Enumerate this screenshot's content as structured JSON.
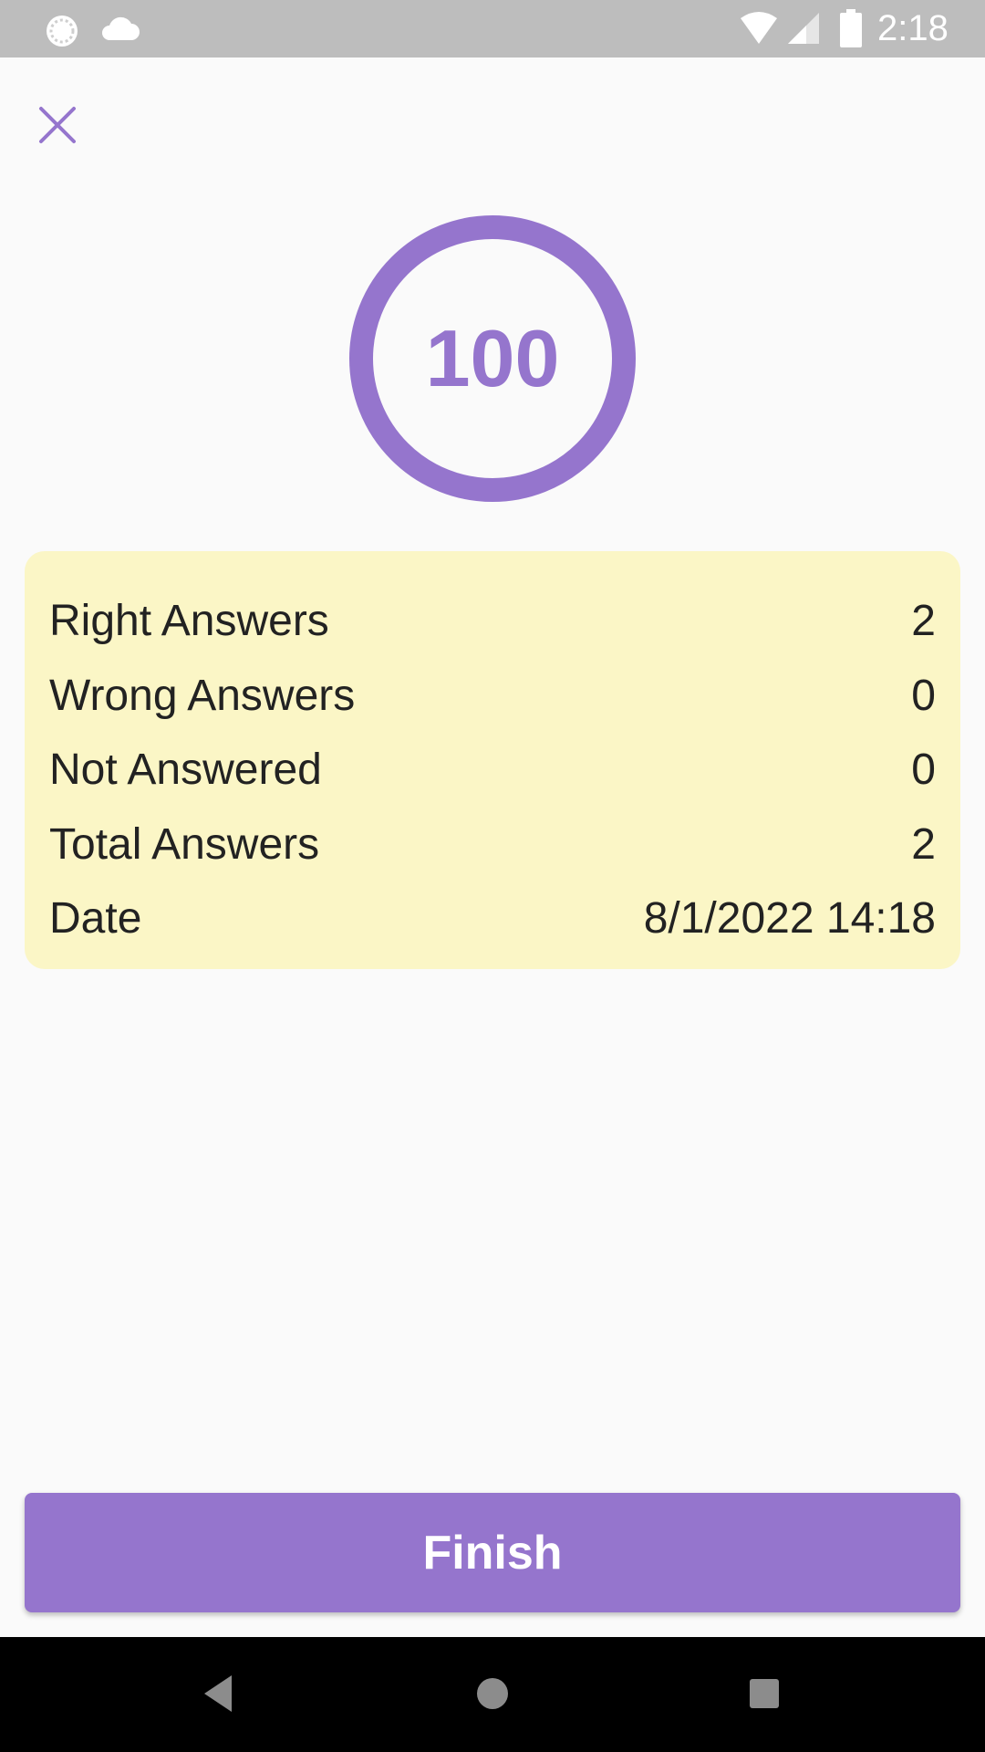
{
  "status_bar": {
    "time": "2:18",
    "icons": [
      "sync-icon",
      "cloud-icon",
      "wifi-icon",
      "signal-icon",
      "battery-icon"
    ],
    "background_color": "#bdbdbd"
  },
  "close_icon": "close-icon",
  "score": {
    "value": "100",
    "ring_color": "#9575cd"
  },
  "results": {
    "card_color": "#fbf6c6",
    "rows": [
      {
        "label": "Right Answers",
        "value": "2"
      },
      {
        "label": "Wrong Answers",
        "value": "0"
      },
      {
        "label": "Not Answered",
        "value": "0"
      },
      {
        "label": "Total Answers",
        "value": "2"
      },
      {
        "label": "Date",
        "value": "8/1/2022 14:18"
      }
    ]
  },
  "finish_button": {
    "label": "Finish",
    "color": "#9575cd"
  },
  "nav_bar": {
    "icons": [
      "back-icon",
      "home-icon",
      "recents-icon"
    ]
  }
}
